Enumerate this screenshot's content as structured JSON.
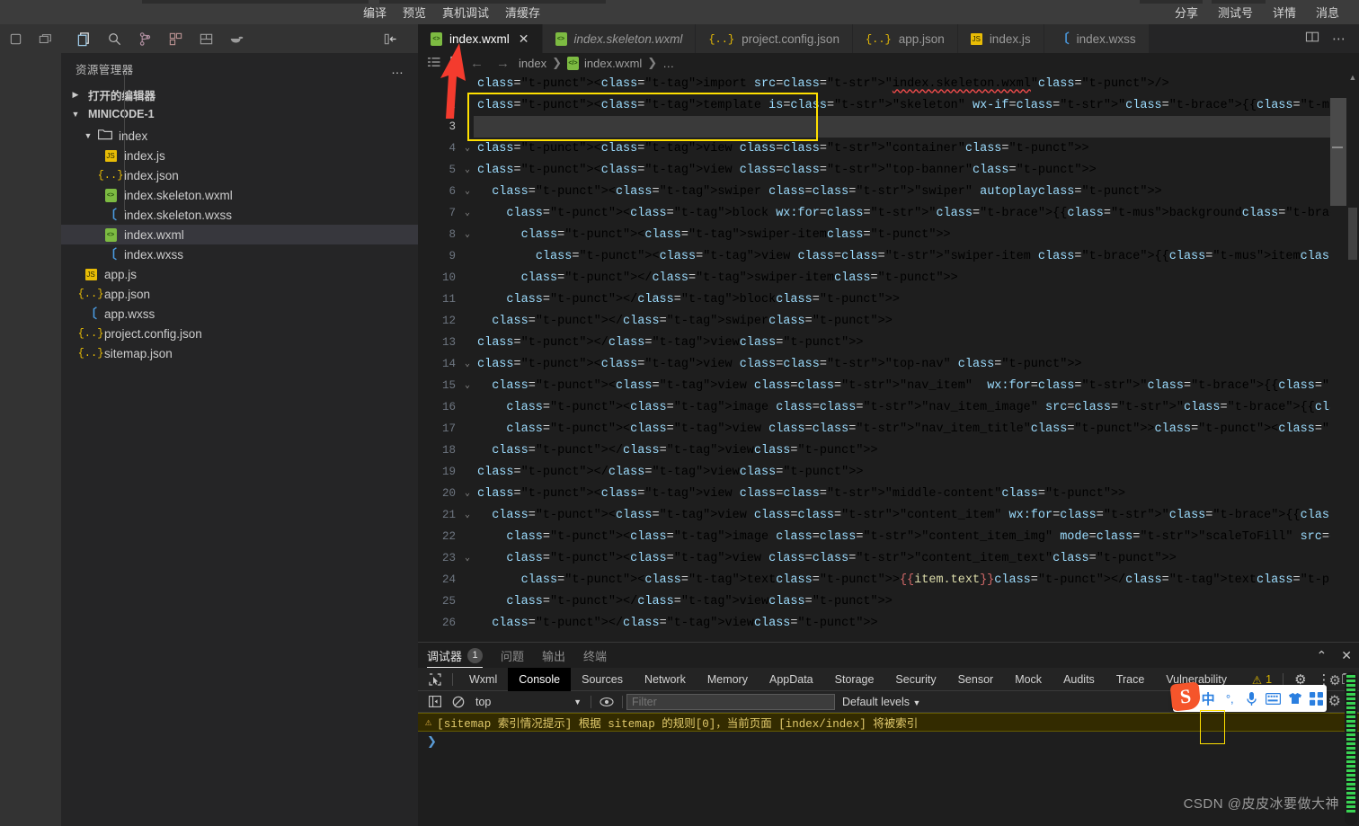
{
  "menubar": {
    "center_items": [
      "编译",
      "预览",
      "真机调试",
      "清缓存"
    ],
    "right_items": [
      "分享",
      "测试号",
      "详情",
      "消息"
    ]
  },
  "activity_bar": {
    "icons": [
      {
        "name": "layout-sidebar-icon",
        "glyph": "▯"
      },
      {
        "name": "layout-panel-icon",
        "glyph": "❐"
      },
      {
        "name": "explorer-icon",
        "glyph": "⧉"
      },
      {
        "name": "search-icon",
        "glyph": "🔍"
      },
      {
        "name": "source-control-icon",
        "glyph": "⑂"
      },
      {
        "name": "extensions-icon",
        "glyph": "⊞"
      },
      {
        "name": "save-all-icon",
        "glyph": "▤"
      },
      {
        "name": "docker-icon",
        "glyph": "🐳"
      },
      {
        "name": "collapse-sidebar-icon",
        "glyph": "⇤"
      }
    ]
  },
  "sidebar": {
    "title": "资源管理器",
    "more_label": "…",
    "open_editors_label": "打开的编辑器",
    "project_label": "MINICODE-1",
    "tree": [
      {
        "label": "index",
        "icon": "folder-icon",
        "indent": 2,
        "twisty": "▼",
        "selected": false
      },
      {
        "label": "index.js",
        "icon": "js-icon",
        "indent": 3,
        "twisty": "",
        "selected": false
      },
      {
        "label": "index.json",
        "icon": "json-icon",
        "indent": 3,
        "twisty": "",
        "selected": false
      },
      {
        "label": "index.skeleton.wxml",
        "icon": "wxml-icon",
        "indent": 3,
        "twisty": "",
        "selected": false
      },
      {
        "label": "index.skeleton.wxss",
        "icon": "wxss-icon",
        "indent": 3,
        "twisty": "",
        "selected": false
      },
      {
        "label": "index.wxml",
        "icon": "wxml-icon",
        "indent": 3,
        "twisty": "",
        "selected": true
      },
      {
        "label": "index.wxss",
        "icon": "wxss-icon",
        "indent": 3,
        "twisty": "",
        "selected": false
      },
      {
        "label": "app.js",
        "icon": "js-icon",
        "indent": 2,
        "twisty": "",
        "selected": false
      },
      {
        "label": "app.json",
        "icon": "json-icon",
        "indent": 2,
        "twisty": "",
        "selected": false
      },
      {
        "label": "app.wxss",
        "icon": "wxss-icon",
        "indent": 2,
        "twisty": "",
        "selected": false
      },
      {
        "label": "project.config.json",
        "icon": "json-icon",
        "indent": 2,
        "twisty": "",
        "selected": false
      },
      {
        "label": "sitemap.json",
        "icon": "json-icon",
        "indent": 2,
        "twisty": "",
        "selected": false
      }
    ]
  },
  "editor": {
    "tabs": [
      {
        "label": "index.wxml",
        "icon": "wxml-icon",
        "active": true,
        "italic": false,
        "close": "✕"
      },
      {
        "label": "index.skeleton.wxml",
        "icon": "wxml-icon",
        "active": false,
        "italic": true,
        "close": ""
      },
      {
        "label": "project.config.json",
        "icon": "json-icon",
        "active": false,
        "italic": false,
        "close": ""
      },
      {
        "label": "app.json",
        "icon": "json-icon",
        "active": false,
        "italic": false,
        "close": ""
      },
      {
        "label": "index.js",
        "icon": "js-icon",
        "active": false,
        "italic": false,
        "close": ""
      },
      {
        "label": "index.wxss",
        "icon": "wxss-icon",
        "active": false,
        "italic": false,
        "close": ""
      }
    ],
    "tab_actions": [
      {
        "name": "split-editor-icon",
        "glyph": "◫"
      },
      {
        "name": "more-actions-icon",
        "glyph": "⋯"
      }
    ],
    "breadcrumb": {
      "back_glyph": "←",
      "forward_glyph": "→",
      "items": [
        "index",
        "index.wxml",
        "…"
      ],
      "separator": "❯"
    },
    "current_line": 3,
    "lines": [
      {
        "n": 1,
        "fold": "",
        "indent": 0
      },
      {
        "n": 2,
        "fold": "",
        "indent": 0
      },
      {
        "n": 3,
        "fold": "",
        "indent": 0
      },
      {
        "n": 4,
        "fold": "⌄",
        "indent": 0
      },
      {
        "n": 5,
        "fold": "⌄",
        "indent": 0
      },
      {
        "n": 6,
        "fold": "⌄",
        "indent": 1
      },
      {
        "n": 7,
        "fold": "⌄",
        "indent": 2
      },
      {
        "n": 8,
        "fold": "⌄",
        "indent": 3
      },
      {
        "n": 9,
        "fold": "",
        "indent": 4
      },
      {
        "n": 10,
        "fold": "",
        "indent": 3
      },
      {
        "n": 11,
        "fold": "",
        "indent": 2
      },
      {
        "n": 12,
        "fold": "",
        "indent": 1
      },
      {
        "n": 13,
        "fold": "",
        "indent": 0
      },
      {
        "n": 14,
        "fold": "⌄",
        "indent": 0
      },
      {
        "n": 15,
        "fold": "⌄",
        "indent": 1
      },
      {
        "n": 16,
        "fold": "",
        "indent": 2
      },
      {
        "n": 17,
        "fold": "",
        "indent": 2
      },
      {
        "n": 18,
        "fold": "",
        "indent": 1
      },
      {
        "n": 19,
        "fold": "",
        "indent": 0
      },
      {
        "n": 20,
        "fold": "⌄",
        "indent": 0
      },
      {
        "n": 21,
        "fold": "⌄",
        "indent": 1
      },
      {
        "n": 22,
        "fold": "",
        "indent": 2
      },
      {
        "n": 23,
        "fold": "⌄",
        "indent": 2
      },
      {
        "n": 24,
        "fold": "",
        "indent": 3
      },
      {
        "n": 25,
        "fold": "",
        "indent": 2
      },
      {
        "n": 26,
        "fold": "",
        "indent": 1
      }
    ],
    "source_text": [
      "<import src=\"index.skeleton.wxml\"/>",
      "<template is=\"skeleton\" wx-if=\"{{loading}}\" />",
      "",
      "<view class=\"container\">",
      "<view class=\"top-banner\">",
      "  <swiper class=\"swiper\" autoplay>",
      "    <block wx:for=\"{{background}}\" wx:key=\"*this\">",
      "      <swiper-item>",
      "        <view class=\"swiper-item {{item}}\"></view>",
      "      </swiper-item>",
      "    </block>",
      "  </swiper>",
      "</view>",
      "<view class=\"top-nav\" >",
      "  <view class=\"nav_item\"  wx:for=\"{{navs}}\" wx:key=\"*this\">",
      "    <image class=\"nav_item_image\" src=\"{{item}}\"></image>",
      "    <view class=\"nav_item_title\"><text>皮皮标题</text></view>",
      "  </view>",
      "</view>",
      "<view class=\"middle-content\">",
      "  <view class=\"content_item\" wx:for=\"{{list}}\" wx:key=\"id\" >",
      "    <image class=\"content_item_img\" mode=\"scaleToFill\" src=\"{{item.icon}}\"></image>",
      "    <view class=\"content_item_text\">",
      "      <text>{{item.text}}</text>",
      "    </view>",
      "  </view>"
    ]
  },
  "panel": {
    "tabs": [
      {
        "label": "调试器",
        "badge": "1",
        "active": true
      },
      {
        "label": "问题",
        "badge": "",
        "active": false
      },
      {
        "label": "输出",
        "badge": "",
        "active": false
      },
      {
        "label": "终端",
        "badge": "",
        "active": false
      }
    ],
    "actions": [
      {
        "name": "maximize-panel-icon",
        "glyph": "⌃"
      },
      {
        "name": "close-panel-icon",
        "glyph": "✕"
      }
    ],
    "devtools": {
      "inspect_icon": "cursor-select-icon",
      "tabs": [
        "Wxml",
        "Console",
        "Sources",
        "Network",
        "Memory",
        "AppData",
        "Storage",
        "Security",
        "Sensor",
        "Mock",
        "Audits",
        "Trace",
        "Vulnerability"
      ],
      "active_tab": "Console",
      "warning_count": "1",
      "right_icons": [
        {
          "name": "settings-gear-icon",
          "glyph": "⚙"
        },
        {
          "name": "more-vertical-icon",
          "glyph": "⋮"
        },
        {
          "name": "dock-side-icon",
          "glyph": "❐"
        }
      ]
    },
    "filterbar": {
      "sidebar_toggle_icon": "show-console-sidebar-icon",
      "clear_icon": "clear-console-icon",
      "context": "top",
      "context_caret": "▼",
      "eye_icon": "live-expression-icon",
      "filter_placeholder": "Filter",
      "filter_value": "",
      "levels_label": "Default levels",
      "levels_caret": "▼",
      "settings_icon": "console-settings-icon"
    },
    "console": {
      "warning_icon": "warning-triangle-icon",
      "message": "[sitemap 索引情况提示] 根据 sitemap 的规则[0]，当前页面 [index/index] 将被索引",
      "prompt": "❯"
    }
  },
  "ime": {
    "logo_letter": "S",
    "icons": [
      {
        "name": "ime-chinese-mode-icon",
        "glyph": "中"
      },
      {
        "name": "ime-punctuation-icon",
        "glyph": "°,"
      },
      {
        "name": "ime-voice-input-icon",
        "glyph": "🎤"
      },
      {
        "name": "ime-keyboard-icon",
        "glyph": "⌨"
      },
      {
        "name": "ime-skin-icon",
        "glyph": "👕"
      },
      {
        "name": "ime-toolbox-icon",
        "glyph": "▦"
      }
    ]
  },
  "watermark": "CSDN @皮皮冰要做大神"
}
